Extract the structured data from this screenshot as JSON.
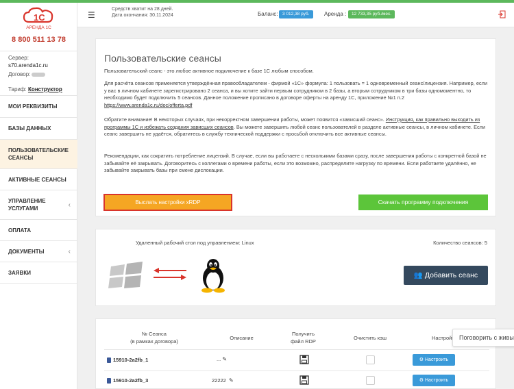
{
  "sidebar": {
    "logo_text": "АРЕНДА 1С",
    "phone": "8 800 511 13 78",
    "server_label": "Сервер:",
    "server_value": "s70.arenda1c.ru",
    "contract_label": "Договор:",
    "tariff_label": "Тариф:",
    "tariff_value": "Конструктор",
    "items": [
      {
        "label": "МОИ РЕКВИЗИТЫ"
      },
      {
        "label": "БАЗЫ ДАННЫХ"
      },
      {
        "label": "ПОЛЬЗОВАТЕЛЬСКИЕ СЕАНСЫ"
      },
      {
        "label": "АКТИВНЫЕ СЕАНСЫ"
      },
      {
        "label": "УПРАВЛЕНИЕ УСЛУГАМИ"
      },
      {
        "label": "ОПЛАТА"
      },
      {
        "label": "ДОКУМЕНТЫ"
      },
      {
        "label": "ЗАЯВКИ"
      }
    ]
  },
  "header": {
    "funds_line": "Средств хватит на 28 дней.",
    "end_line": "Дата окончания: 30.11.2024",
    "balance_label": "Баланс:",
    "balance_value": "3 012,38 руб.",
    "rent_label": "Аренда :",
    "rent_value": "12 733,35 руб./мес."
  },
  "main": {
    "title": "Пользовательские сеансы",
    "p1": "Пользовательский сеанс - это любое активное подключение к базе 1С любым способом.",
    "p2": "Для расчёта сеансов применяется утверждённая правообладателем - фирмой «1С» формула: 1 пользовать = 1 одновременный сеанс/лицензия. Например, если у вас в личном кабинете зарегистрировано 2 сеанса, и вы хотите зайти первым сотрудником в 2 базы, а вторым сотрудником в три базы одномоментно, то необходимо будет подключить 5 сеансов. Данное положение прописано в договоре оферты на аренду 1С, приложение №1 п.2",
    "p2_link": "https://www.arenda1c.ru/doc/offerta.pdf",
    "p3_a": "Обратите внимание! В некоторых случаях, при некорректном завершении работы, может появится «зависший сеанс».",
    "p3_link": "Инструкция, как правильно выходить из программы 1С и избежать создания зависших сеансов",
    "p3_b": ". Вы можете завершить любой сеанс пользователей в разделе активные сеансы, в личном кабинете. Если сеанс завершить не удаётся, обратитесь в службу технической поддержки с просьбой отключить все активные сеансы.",
    "p4": "Рекомендации, как сократить потребление лицензий. В случае, если вы работаете с несколькими базами сразу, после завершения работы с конкретной базой не забывайте её закрывать. Договоритесь с коллегами о времени работы, если это возможно, распределите нагрузку по времени. Если работаете удалённо, не забывайте закрывать базы при смене дислокации.",
    "btn_rdp": "Выслать настройки xRDP",
    "btn_download": "Скачать программу подключения"
  },
  "remote": {
    "label": "Удаленный рабочий стол под управлением: Linux",
    "count_label": "Количество сеансов: 5",
    "add_button": "Добавить сеанс"
  },
  "table": {
    "headers": {
      "session_num": "№ Сеанса",
      "session_sub": "(в рамках договора)",
      "description": "Описание",
      "rdp_1": "Получить",
      "rdp_2": "файл RDP",
      "clear_cache": "Очистить кэш",
      "settings": "Настройки"
    },
    "rows": [
      {
        "session": "15910-2a2fb_1",
        "description": "...",
        "button": "Настроить"
      },
      {
        "session": "15910-2a2fb_3",
        "description": "22222",
        "button": "Настроить"
      }
    ]
  },
  "chat": {
    "text": "Поговорить с живым"
  }
}
